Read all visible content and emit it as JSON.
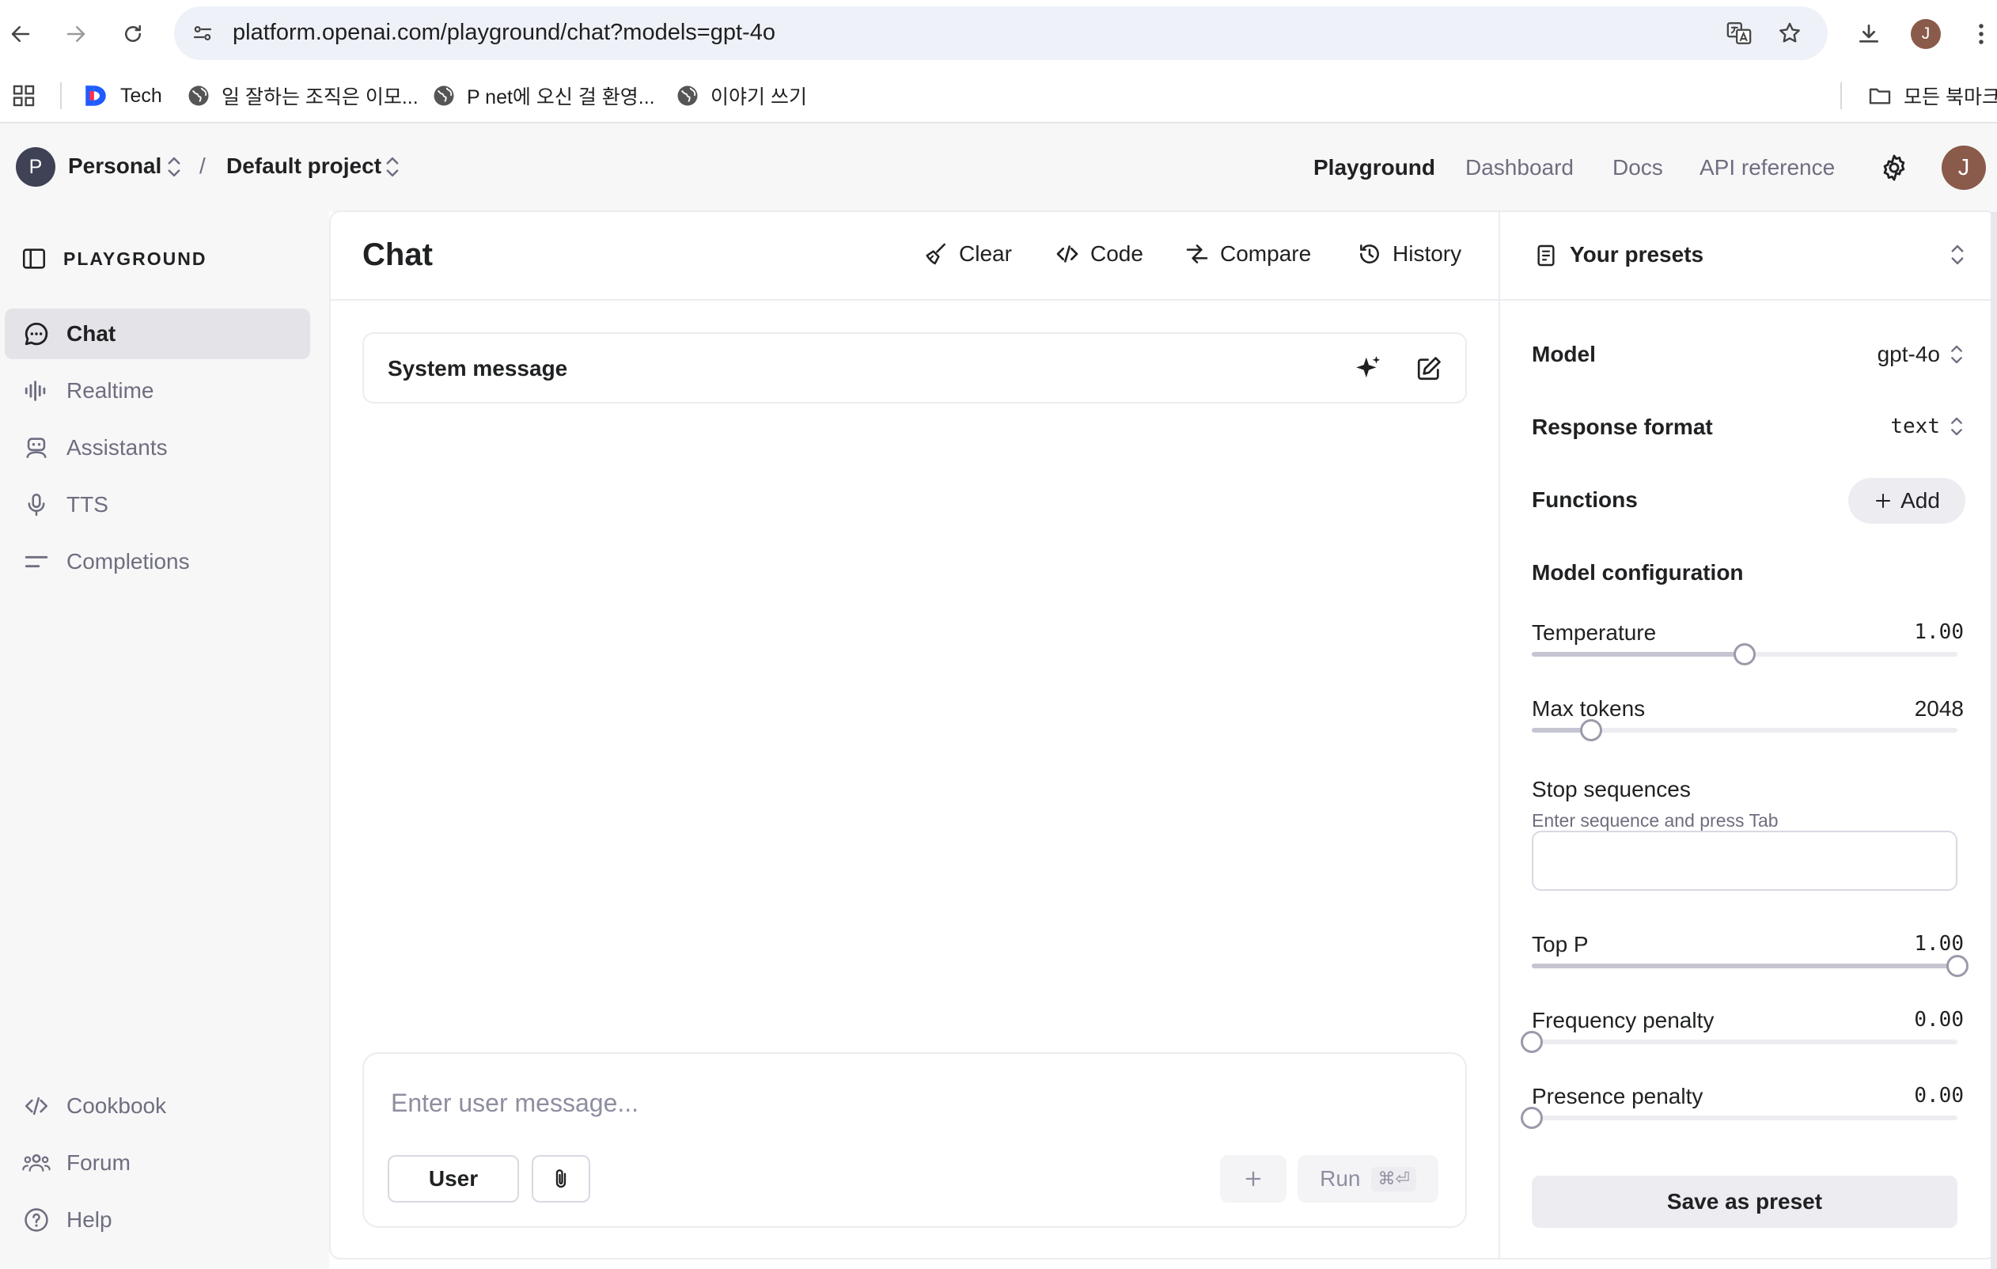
{
  "browser": {
    "url": "platform.openai.com/playground/chat?models=gpt-4o",
    "avatar_initial": "J",
    "bookmarks": [
      {
        "label": "Tech",
        "icon": "tech-logo-icon"
      },
      {
        "label": "일 잘하는 조직은 이모...",
        "icon": "globe-icon"
      },
      {
        "label": "P net에 오신 걸 환영...",
        "icon": "globe-icon"
      },
      {
        "label": "이야기 쓰기",
        "icon": "globe-icon"
      }
    ],
    "all_bookmarks_label": "모든 북마크"
  },
  "header": {
    "org_initial": "P",
    "org_name": "Personal",
    "separator": "/",
    "project_name": "Default project",
    "nav": [
      {
        "label": "Playground",
        "active": true
      },
      {
        "label": "Dashboard",
        "active": false
      },
      {
        "label": "Docs",
        "active": false
      },
      {
        "label": "API reference",
        "active": false
      }
    ],
    "user_initial": "J"
  },
  "sidebar": {
    "title": "PLAYGROUND",
    "items": [
      {
        "label": "Chat",
        "icon": "chat-bubble-icon",
        "active": true
      },
      {
        "label": "Realtime",
        "icon": "audio-wave-icon",
        "active": false
      },
      {
        "label": "Assistants",
        "icon": "robot-icon",
        "active": false
      },
      {
        "label": "TTS",
        "icon": "microphone-icon",
        "active": false
      },
      {
        "label": "Completions",
        "icon": "lines-icon",
        "active": false
      }
    ],
    "footer": [
      {
        "label": "Cookbook",
        "icon": "code-icon"
      },
      {
        "label": "Forum",
        "icon": "people-icon"
      },
      {
        "label": "Help",
        "icon": "help-circle-icon"
      }
    ]
  },
  "chat": {
    "title": "Chat",
    "toolbar": {
      "clear": "Clear",
      "code": "Code",
      "compare": "Compare",
      "history": "History"
    },
    "system_message_label": "System message",
    "composer": {
      "placeholder": "Enter user message...",
      "value": "",
      "role": "User",
      "run_label": "Run",
      "run_shortcut": "⌘⏎"
    }
  },
  "config": {
    "presets_label": "Your presets",
    "model_label": "Model",
    "model_value": "gpt-4o",
    "response_format_label": "Response format",
    "response_format_value": "text",
    "functions_label": "Functions",
    "functions_add": "Add",
    "model_config_label": "Model configuration",
    "temperature": {
      "label": "Temperature",
      "value": "1.00",
      "fraction": 0.5
    },
    "max_tokens": {
      "label": "Max tokens",
      "value": "2048",
      "fraction": 0.14
    },
    "stop_sequences": {
      "label": "Stop sequences",
      "hint": "Enter sequence and press Tab",
      "value": ""
    },
    "top_p": {
      "label": "Top P",
      "value": "1.00",
      "fraction": 1.0
    },
    "frequency_penalty": {
      "label": "Frequency penalty",
      "value": "0.00",
      "fraction": 0.0
    },
    "presence_penalty": {
      "label": "Presence penalty",
      "value": "0.00",
      "fraction": 0.0
    },
    "save_preset": "Save as preset"
  }
}
